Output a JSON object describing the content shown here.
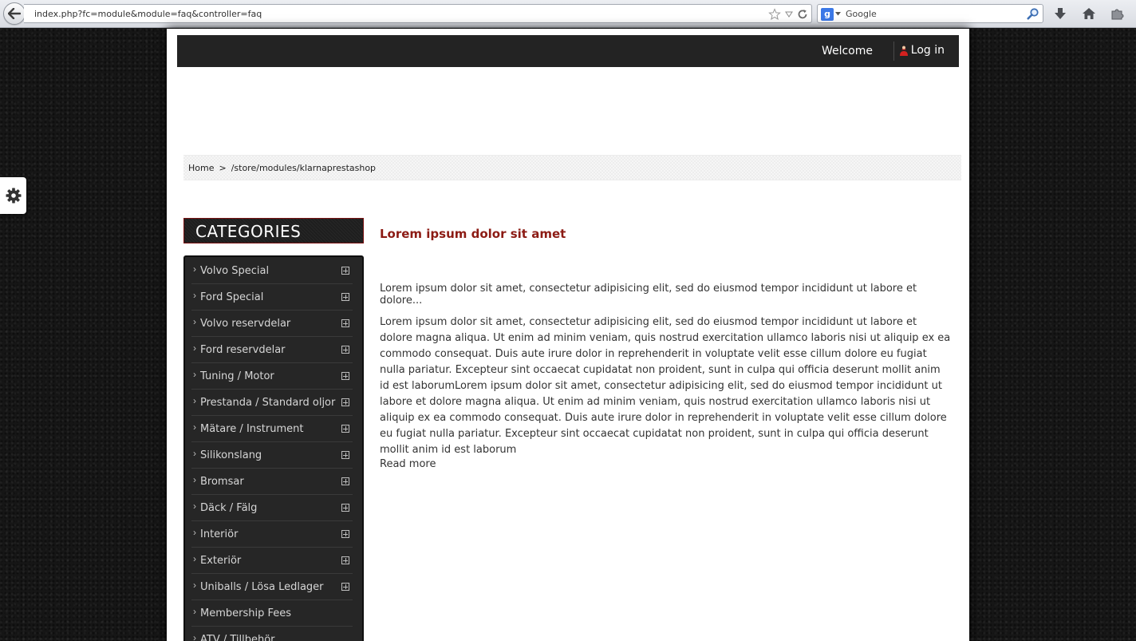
{
  "browser": {
    "url": "index.php?fc=module&module=faq&controller=faq",
    "search_placeholder": "Google",
    "search_engine_letter": "g"
  },
  "header": {
    "welcome": "Welcome",
    "login": "Log in"
  },
  "breadcrumb": {
    "home": "Home",
    "separator": ">",
    "path": "/store/modules/klarnaprestashop"
  },
  "categories": {
    "title": "CATEGORIES",
    "items": [
      {
        "label": "Volvo Special",
        "expandable": true
      },
      {
        "label": "Ford Special",
        "expandable": true
      },
      {
        "label": "Volvo reservdelar",
        "expandable": true
      },
      {
        "label": "Ford reservdelar",
        "expandable": true
      },
      {
        "label": "Tuning / Motor",
        "expandable": true
      },
      {
        "label": "Prestanda / Standard oljor",
        "expandable": true
      },
      {
        "label": "Mätare / Instrument",
        "expandable": true
      },
      {
        "label": "Silikonslang",
        "expandable": true
      },
      {
        "label": "Bromsar",
        "expandable": true
      },
      {
        "label": "Däck / Fälg",
        "expandable": true
      },
      {
        "label": "Interiör",
        "expandable": true
      },
      {
        "label": "Exteriör",
        "expandable": true
      },
      {
        "label": "Uniballs / Lösa Ledlager",
        "expandable": true
      },
      {
        "label": "Membership Fees",
        "expandable": false
      },
      {
        "label": "ATV / Tillbehör",
        "expandable": false
      }
    ]
  },
  "content": {
    "title": "Lorem ipsum dolor sit amet",
    "intro": "Lorem ipsum dolor sit amet, consectetur adipisicing elit, sed do eiusmod tempor incididunt ut labore et dolore...",
    "body": "Lorem ipsum dolor sit amet, consectetur adipisicing elit, sed do eiusmod tempor incididunt ut labore et dolore magna aliqua. Ut enim ad minim veniam, quis nostrud exercitation ullamco laboris nisi ut aliquip ex ea commodo consequat. Duis aute irure dolor in reprehenderit in voluptate velit esse cillum dolore eu fugiat nulla pariatur. Excepteur sint occaecat cupidatat non proident, sunt in culpa qui officia deserunt mollit anim id est laborumLorem ipsum dolor sit amet, consectetur adipisicing elit, sed do eiusmod tempor incididunt ut labore et dolore magna aliqua. Ut enim ad minim veniam, quis nostrud exercitation ullamco laboris nisi ut aliquip ex ea commodo consequat. Duis aute irure dolor in reprehenderit in voluptate velit esse cillum dolore eu fugiat nulla pariatur. Excepteur sint occaecat cupidatat non proident, sunt in culpa qui officia deserunt mollit anim id est laborum",
    "read_more": "Read more"
  },
  "colors": {
    "accent": "#8c1b14",
    "topbar": "#232323",
    "sidebar": "#262626"
  }
}
